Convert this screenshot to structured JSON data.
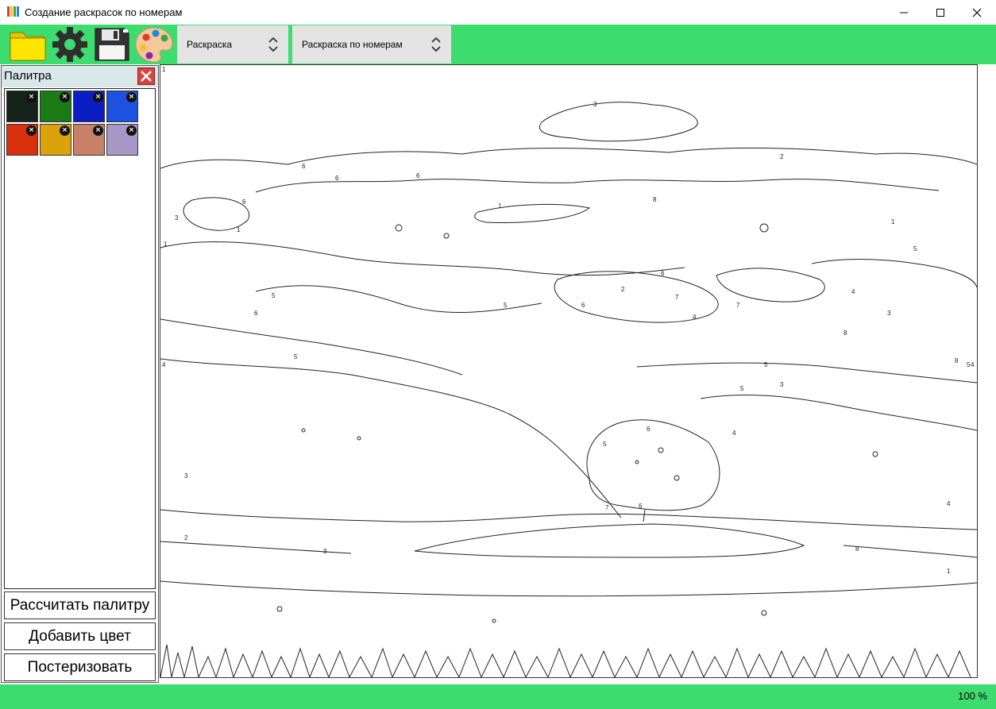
{
  "window": {
    "title": "Создание раскрасок по номерам",
    "minimize_icon": "minimize-icon",
    "maximize_icon": "maximize-icon",
    "close_icon": "close-icon"
  },
  "toolbar": {
    "open_icon": "folder-icon",
    "settings_icon": "gear-icon",
    "save_icon": "floppy-disk-icon",
    "palette_icon": "palette-icon",
    "mode_select": "Раскраска",
    "style_select": "Раскраска по номерам"
  },
  "palette_panel": {
    "title": "Палитра",
    "colors": [
      "#15231b",
      "#1a7b17",
      "#0b1ec4",
      "#1d52e0",
      "#d8300c",
      "#dca20c",
      "#c98068",
      "#a898c8"
    ],
    "buttons": {
      "calculate": "Рассчитать палитру",
      "add_color": "Добавить цвет",
      "posterize": "Постеризовать"
    }
  },
  "canvas": {
    "region_numbers": [
      "1",
      "3",
      "6",
      "2",
      "6",
      "1",
      "3",
      "6",
      "1",
      "6",
      "1",
      "4",
      "5",
      "6",
      "5",
      "5",
      "8",
      "2",
      "6",
      "4",
      "7",
      "6",
      "7",
      "5",
      "3",
      "8",
      "4",
      "8",
      "5",
      "5",
      "6",
      "4",
      "2",
      "6",
      "3",
      "5",
      "1",
      "5",
      "3",
      "8",
      "1",
      "3",
      "7",
      "4",
      "4"
    ]
  },
  "status": {
    "zoom": "100 %"
  },
  "colors": {
    "accent": "#3ddc6f",
    "panel_header": "#d9e7e8",
    "dropdown_bg": "#e3e3e3"
  }
}
